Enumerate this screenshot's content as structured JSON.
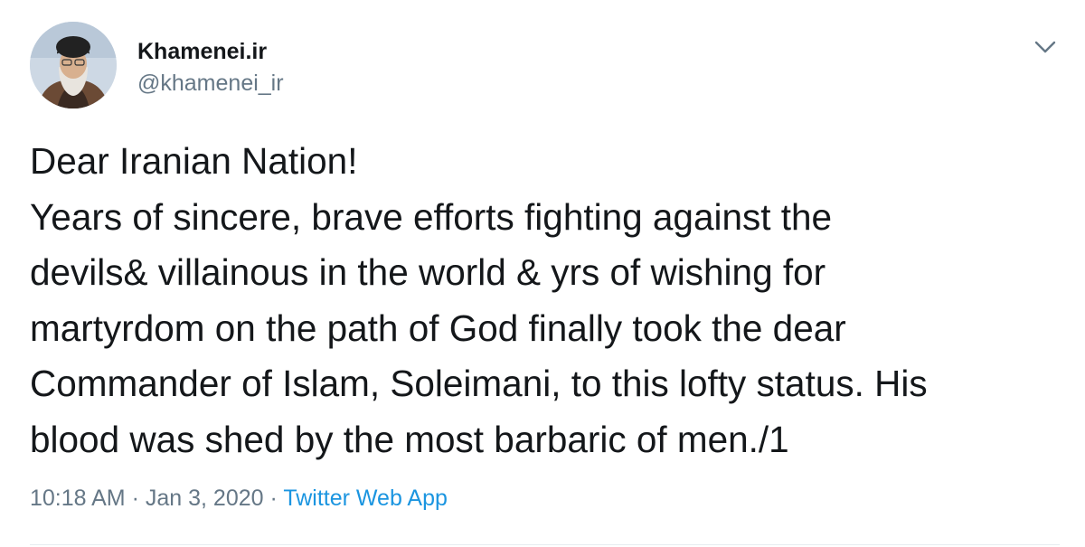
{
  "tweet": {
    "display_name": "Khamenei.ir",
    "handle": "@khamenei_ir",
    "text_lines": [
      "Dear Iranian Nation!",
      "Years of sincere, brave efforts fighting against the",
      "devils& villainous in the world & yrs of wishing for",
      "martyrdom on the path of God finally took the dear",
      "Commander of Islam, Soleimani, to this lofty status. His",
      "blood was shed by the most barbaric of men./1"
    ],
    "time": "10:18 AM",
    "date": "Jan 3, 2020",
    "separator": "·",
    "source": "Twitter Web App",
    "menu_icon": "chevron-down-icon",
    "avatar_icon": "avatar-photo"
  },
  "colors": {
    "text": "#14171a",
    "secondary": "#657786",
    "link": "#1b95e0",
    "divider": "#e6ecf0"
  }
}
